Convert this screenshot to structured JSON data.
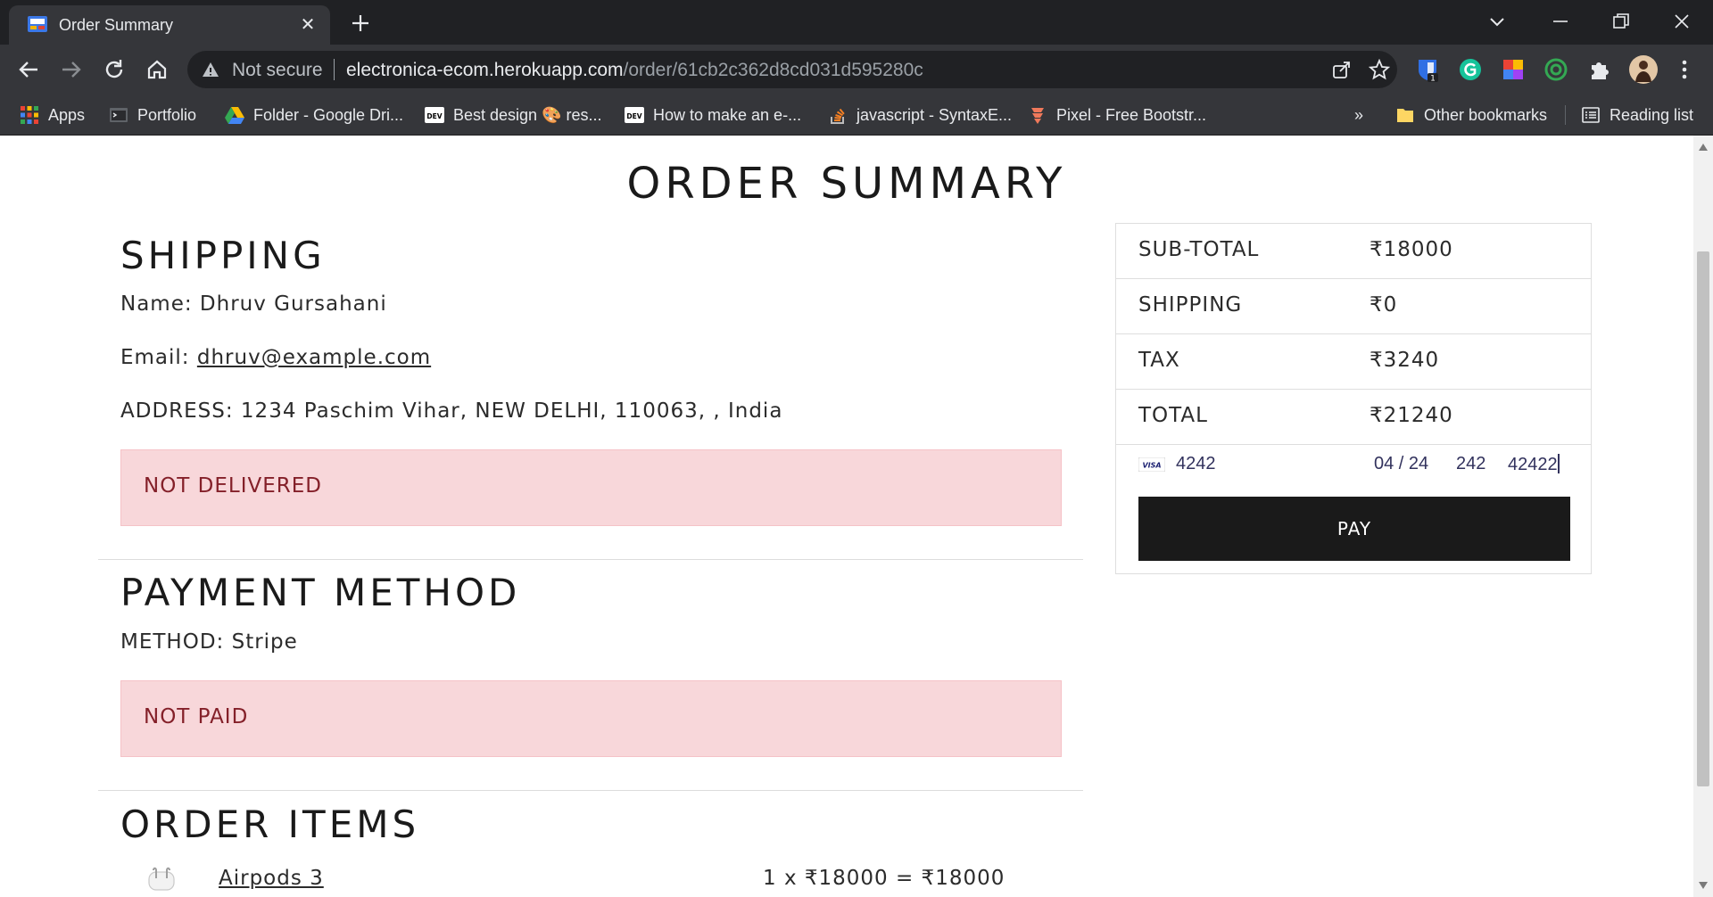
{
  "browser": {
    "tab_title": "Order Summary",
    "omnibox": {
      "security_text": "Not secure",
      "url_host": "electronica-ecom.herokuapp.com",
      "url_path": "/order/61cb2c362d8cd031d595280c"
    },
    "extension_badge": "1",
    "bookmarks": [
      {
        "label": "Apps",
        "icon": "apps-grid-icon"
      },
      {
        "label": "Portfolio",
        "icon": "portfolio-icon"
      },
      {
        "label": "Folder - Google Dri...",
        "icon": "google-drive-icon"
      },
      {
        "label": "Best design 🎨 res...",
        "icon": "dev-icon"
      },
      {
        "label": "How to make an e-...",
        "icon": "dev-icon"
      },
      {
        "label": "javascript - SyntaxE...",
        "icon": "stackoverflow-icon"
      },
      {
        "label": "Pixel - Free Bootstr...",
        "icon": "pixel-icon"
      }
    ],
    "bookmarks_overflow": "»",
    "other_bookmarks": "Other bookmarks",
    "reading_list": "Reading list"
  },
  "page": {
    "title": "ORDER SUMMARY",
    "shipping": {
      "heading": "SHIPPING",
      "name_line": "Name: Dhruv Gursahani",
      "email_label": "Email: ",
      "email": "dhruv@example.com",
      "address_line": "ADDRESS: 1234 Paschim Vihar, NEW DELHI, 110063, , India",
      "status": "NOT DELIVERED"
    },
    "payment": {
      "heading": "PAYMENT METHOD",
      "method_line": "METHOD: Stripe",
      "status": "NOT PAID"
    },
    "order_items": {
      "heading": "ORDER ITEMS",
      "items": [
        {
          "name": "Airpods 3",
          "price_line": "1 x ₹18000 = ₹18000"
        }
      ]
    },
    "summary": {
      "rows": [
        {
          "label": "SUB-TOTAL",
          "value": "₹18000"
        },
        {
          "label": "SHIPPING",
          "value": "₹0"
        },
        {
          "label": "TAX",
          "value": "₹3240"
        },
        {
          "label": "TOTAL",
          "value": "₹21240"
        }
      ],
      "card": {
        "brand": "VISA",
        "number": "4242",
        "expiry": "04 / 24",
        "cvc": "242",
        "zip": "42422"
      },
      "pay_label": "PAY"
    }
  },
  "colors": {
    "chrome_dark": "#202124",
    "chrome_toolbar": "#35363a",
    "alert_bg": "#f8d7da",
    "alert_text": "#842029",
    "pay_button": "#1a1a1a"
  }
}
